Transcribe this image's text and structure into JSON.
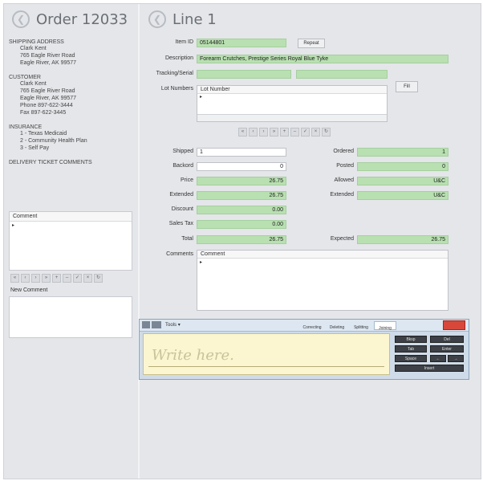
{
  "header": {
    "left_title": "Order 12033",
    "right_title": "Line 1",
    "back_glyph": "❮"
  },
  "shipping": {
    "title": "SHIPPING ADDRESS",
    "lines": [
      "Clark Kent",
      "765 Eagle River Road",
      "Eagle River, AK 99577"
    ]
  },
  "customer": {
    "title": "CUSTOMER",
    "lines": [
      "Clark Kent",
      "765 Eagle River Road",
      "Eagle River, AK 99577",
      "Phone 897-622-3444",
      "Fax 897-622-3445"
    ]
  },
  "insurance": {
    "title": "INSURANCE",
    "lines": [
      "1 - Texas Medicaid",
      "2 - Community Health Plan",
      "3 - Self Pay"
    ]
  },
  "delivery_title": "DELIVERY TICKET COMMENTS",
  "left_comment_header": "Comment",
  "left_nav": [
    "«",
    "‹",
    "›",
    "»",
    "+",
    "–",
    "✓",
    "×",
    "↻"
  ],
  "new_comment_label": "New Comment",
  "line": {
    "item_id_label": "Item ID",
    "item_id": "05144801",
    "repeat_label": "Repeat",
    "description_label": "Description",
    "description": "Forearm Crutches, Prestige Series Royal Blue Tyke",
    "tracking_label": "Tracking/Serial",
    "lot_label": "Lot Numbers",
    "lot_col": "Lot Number",
    "fill_label": "Fill",
    "nav": [
      "«",
      "‹",
      "›",
      "»",
      "+",
      "–",
      "✓",
      "×",
      "↻"
    ],
    "shipped_label": "Shipped",
    "shipped": "1",
    "backord_label": "Backord",
    "backord": "0",
    "price_label": "Price",
    "price": "26.75",
    "extended_label": "Extended",
    "extended": "26.75",
    "discount_label": "Discount",
    "discount": "0.00",
    "sales_tax_label": "Sales Tax",
    "sales_tax": "0.00",
    "total_label": "Total",
    "total": "26.75",
    "ordered_label": "Ordered",
    "ordered": "1",
    "posted_label": "Posted",
    "posted": "0",
    "allowed_label": "Allowed",
    "allowed": "U&C",
    "ext2_label": "Extended",
    "ext2": "U&C",
    "expected_label": "Expected",
    "expected": "26.75",
    "comments_label": "Comments",
    "comments_col": "Comment"
  },
  "input_panel": {
    "tools_label": "Tools",
    "tabs": [
      "Correcting",
      "Deleting",
      "Splitting",
      "Joining"
    ],
    "write_placeholder": "Write here.",
    "keys": [
      "Bksp",
      "Del",
      "Tab",
      "Enter",
      "Space",
      "←",
      "→",
      "Insert"
    ]
  }
}
